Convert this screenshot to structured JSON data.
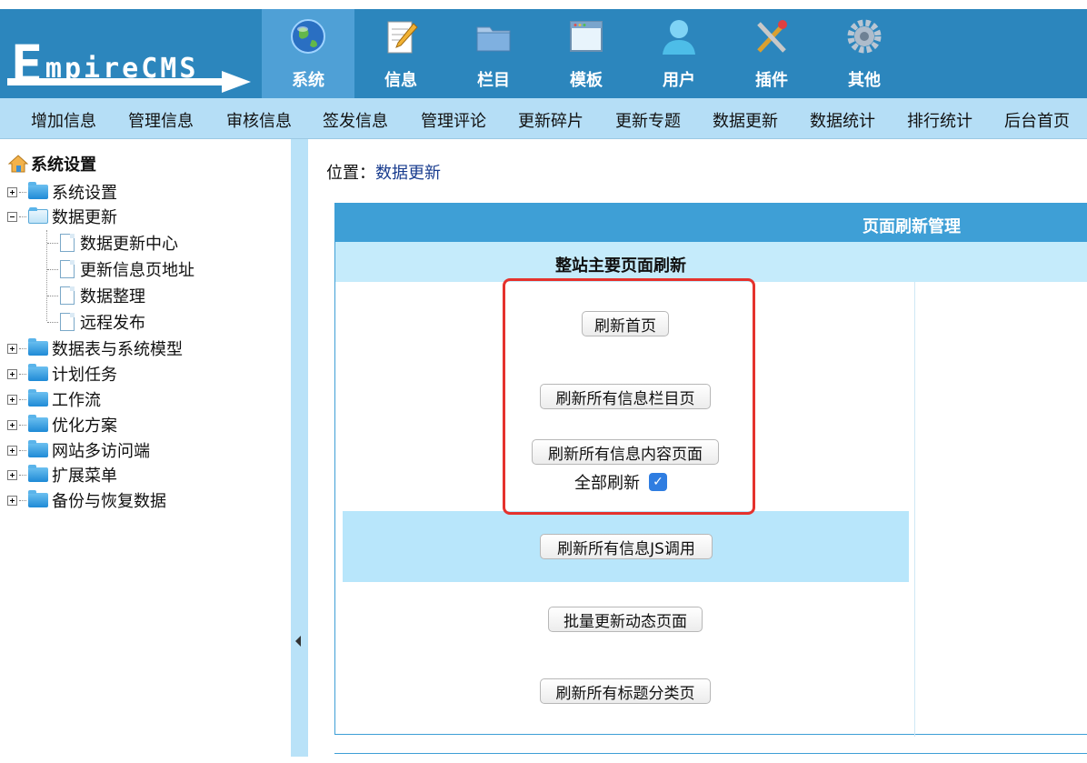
{
  "logo": {
    "first_letter": "E",
    "rest": "mpireCMS"
  },
  "nav": {
    "tabs": [
      {
        "label": "系统",
        "icon": "globe-icon",
        "active": true
      },
      {
        "label": "信息",
        "icon": "notepad-pencil-icon",
        "active": false
      },
      {
        "label": "栏目",
        "icon": "folder-icon",
        "active": false
      },
      {
        "label": "模板",
        "icon": "window-icon",
        "active": false
      },
      {
        "label": "用户",
        "icon": "user-icon",
        "active": false
      },
      {
        "label": "插件",
        "icon": "tools-icon",
        "active": false
      },
      {
        "label": "其他",
        "icon": "gear-icon",
        "active": false
      }
    ]
  },
  "subnav": {
    "items": [
      "增加信息",
      "管理信息",
      "审核信息",
      "签发信息",
      "管理评论",
      "更新碎片",
      "更新专题",
      "数据更新",
      "数据统计",
      "排行统计",
      "后台首页"
    ]
  },
  "sidebar": {
    "root": "系统设置",
    "items": [
      {
        "label": "系统设置",
        "expanded": false
      },
      {
        "label": "数据更新",
        "expanded": true
      },
      {
        "label": "数据更新中心"
      },
      {
        "label": "更新信息页地址"
      },
      {
        "label": "数据整理"
      },
      {
        "label": "远程发布"
      },
      {
        "label": "数据表与系统模型",
        "expanded": false
      },
      {
        "label": "计划任务",
        "expanded": false
      },
      {
        "label": "工作流",
        "expanded": false
      },
      {
        "label": "优化方案",
        "expanded": false
      },
      {
        "label": "网站多访问端",
        "expanded": false
      },
      {
        "label": "扩展菜单",
        "expanded": false
      },
      {
        "label": "备份与恢复数据",
        "expanded": false
      }
    ]
  },
  "location": {
    "prefix": "位置：",
    "link": "数据更新"
  },
  "panel": {
    "title": "页面刷新管理",
    "section_title": "整站主要页面刷新",
    "buttons": {
      "refresh_home": "刷新首页",
      "refresh_columns": "刷新所有信息栏目页",
      "refresh_content": "刷新所有信息内容页面",
      "refresh_js": "刷新所有信息JS调用",
      "batch_dynamic": "批量更新动态页面",
      "refresh_title_class": "刷新所有标题分类页"
    },
    "all_refresh": {
      "label": "全部刷新",
      "checked": true
    }
  },
  "colors": {
    "header": "#2c86bd",
    "active_tab": "#4fa0d6",
    "subnav": "#b5def6",
    "highlight": "#e5322d"
  }
}
